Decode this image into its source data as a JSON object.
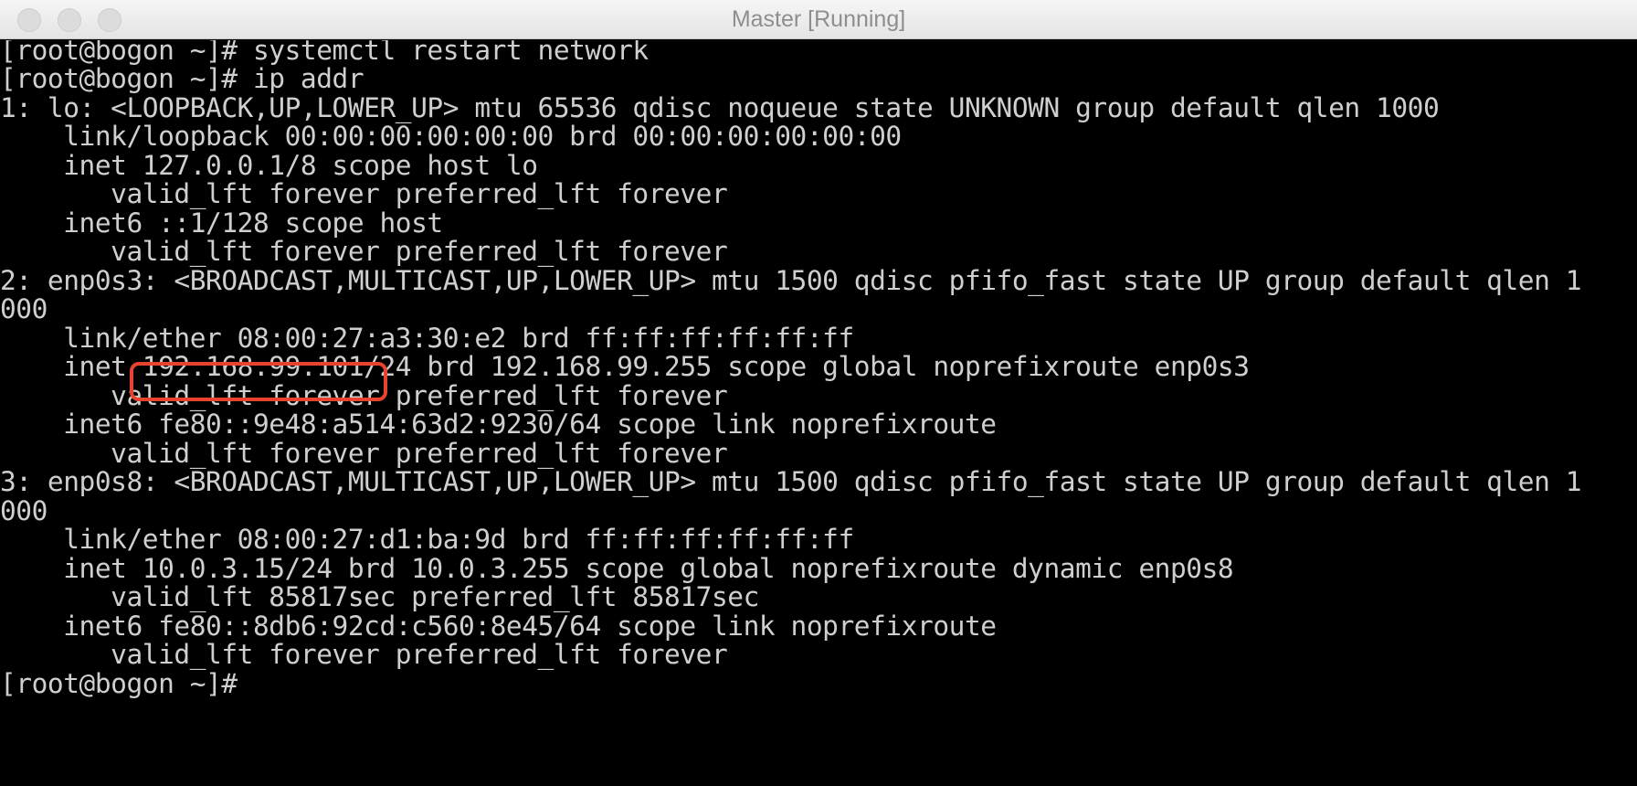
{
  "window": {
    "title": "Master [Running]"
  },
  "terminal": {
    "lines": [
      "[root@bogon ~]# systemctl restart network",
      "[root@bogon ~]# ip addr",
      "1: lo: <LOOPBACK,UP,LOWER_UP> mtu 65536 qdisc noqueue state UNKNOWN group default qlen 1000",
      "    link/loopback 00:00:00:00:00:00 brd 00:00:00:00:00:00",
      "    inet 127.0.0.1/8 scope host lo",
      "       valid_lft forever preferred_lft forever",
      "    inet6 ::1/128 scope host",
      "       valid_lft forever preferred_lft forever",
      "2: enp0s3: <BROADCAST,MULTICAST,UP,LOWER_UP> mtu 1500 qdisc pfifo_fast state UP group default qlen 1",
      "000",
      "    link/ether 08:00:27:a3:30:e2 brd ff:ff:ff:ff:ff:ff",
      "    inet 192.168.99.101/24 brd 192.168.99.255 scope global noprefixroute enp0s3",
      "       valid_lft forever preferred_lft forever",
      "    inet6 fe80::9e48:a514:63d2:9230/64 scope link noprefixroute",
      "       valid_lft forever preferred_lft forever",
      "3: enp0s8: <BROADCAST,MULTICAST,UP,LOWER_UP> mtu 1500 qdisc pfifo_fast state UP group default qlen 1",
      "000",
      "    link/ether 08:00:27:d1:ba:9d brd ff:ff:ff:ff:ff:ff",
      "    inet 10.0.3.15/24 brd 10.0.3.255 scope global noprefixroute dynamic enp0s8",
      "       valid_lft 85817sec preferred_lft 85817sec",
      "    inet6 fe80::8db6:92cd:c560:8e45/64 scope link noprefixroute",
      "       valid_lft forever preferred_lft forever",
      "[root@bogon ~]#"
    ],
    "highlight": {
      "text": "192.168.99.101",
      "color": "#e8432f"
    },
    "foreground_color": "#cfcfcf",
    "background_color": "#000000"
  }
}
